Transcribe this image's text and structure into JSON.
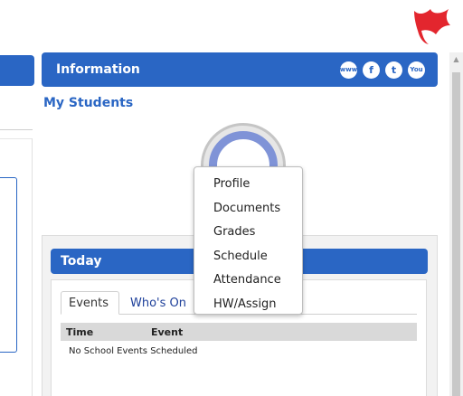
{
  "info_panel": {
    "title": "Information",
    "social_icons": [
      "web-icon",
      "facebook-icon",
      "twitter-icon",
      "youtube-icon"
    ],
    "social_glyphs": [
      "www",
      "f",
      "t",
      "You"
    ],
    "my_students_label": "My Students"
  },
  "student_menu": {
    "items": [
      "Profile",
      "Documents",
      "Grades",
      "Schedule",
      "Attendance",
      "HW/Assign"
    ]
  },
  "today_panel": {
    "title": "Today",
    "tabs": [
      "Events",
      "Who's On"
    ],
    "columns": [
      "Time",
      "Event"
    ],
    "empty_message": "No School Events Scheduled"
  },
  "colors": {
    "accent": "#2a66c4",
    "logo_red": "#e3262e"
  }
}
